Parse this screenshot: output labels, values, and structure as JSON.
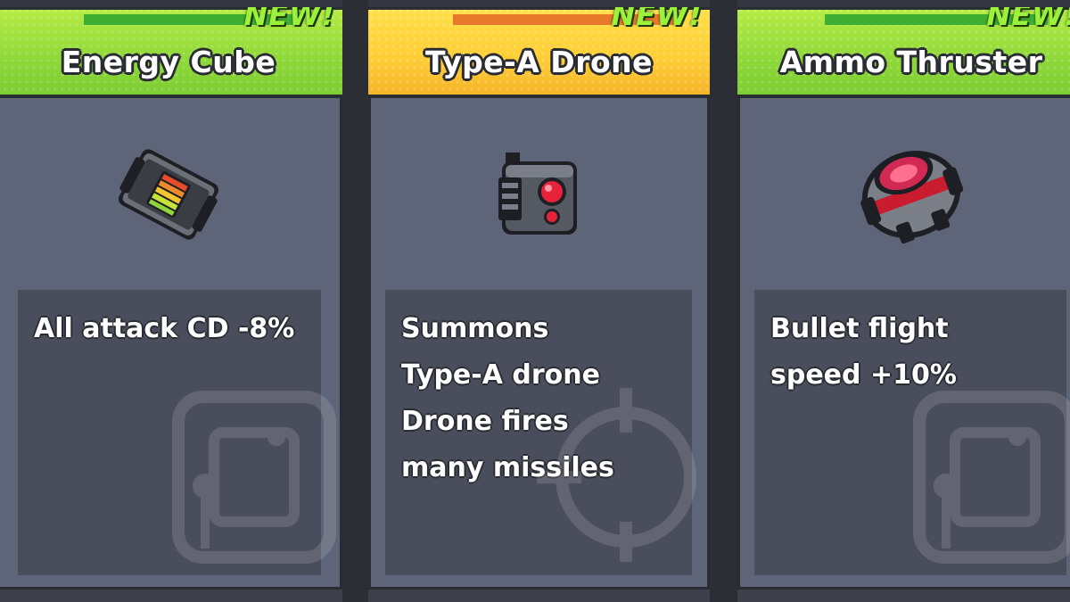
{
  "cards": [
    {
      "title": "Energy Cube",
      "badge": "NEW!",
      "icon": "energy-cube-icon",
      "description": "All attack CD -8%",
      "header_color": "#8fd83a"
    },
    {
      "title": "Type-A Drone",
      "badge": "NEW!",
      "icon": "drone-icon",
      "description": "Summons\nType-A drone\nDrone fires\nmany missiles",
      "header_color": "#ffcf38"
    },
    {
      "title": "Ammo Thruster",
      "badge": "NEW!",
      "icon": "ammo-thruster-icon",
      "description": "Bullet flight\nspeed +10%",
      "header_color": "#8fd83a"
    }
  ]
}
